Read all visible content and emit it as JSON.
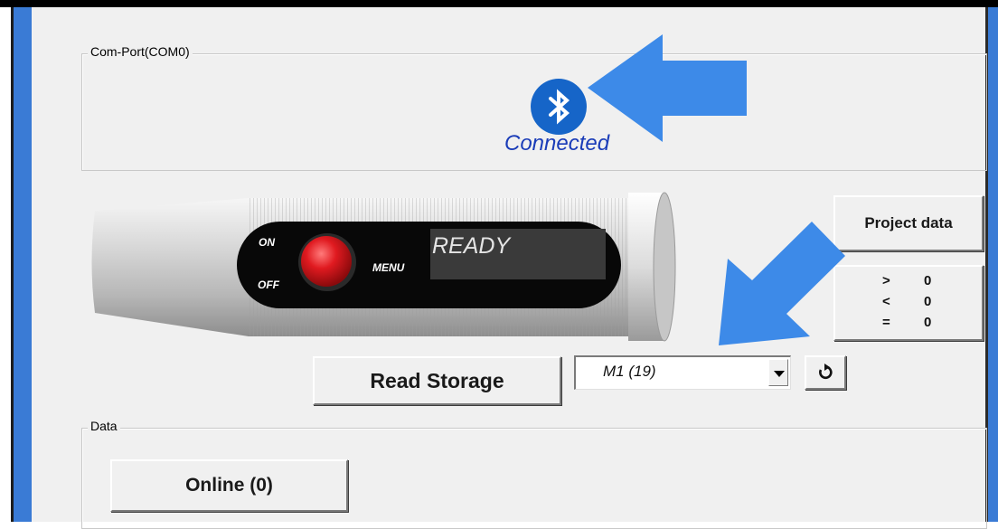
{
  "comport": {
    "legend": "Com-Port(COM0)",
    "status": "Connected",
    "icon": "bluetooth-icon"
  },
  "device": {
    "on_label": "ON",
    "off_label": "OFF",
    "menu_label": "MENU",
    "display_text": "READY"
  },
  "project_button": {
    "label": "Project data"
  },
  "counters": [
    {
      "symbol": ">",
      "value": "0"
    },
    {
      "symbol": "<",
      "value": "0"
    },
    {
      "symbol": "=",
      "value": "0"
    }
  ],
  "storage": {
    "read_label": "Read Storage",
    "selected": "M1  (19)",
    "refresh_icon": "refresh-icon"
  },
  "data_group": {
    "legend": "Data",
    "online_label": "Online (0)"
  },
  "colors": {
    "arrow": "#3d8ae8",
    "bluetooth": "#1665c8",
    "connected_text": "#1a3cb8",
    "power_button": "#d9141b",
    "frame": "#3a7bd5"
  }
}
